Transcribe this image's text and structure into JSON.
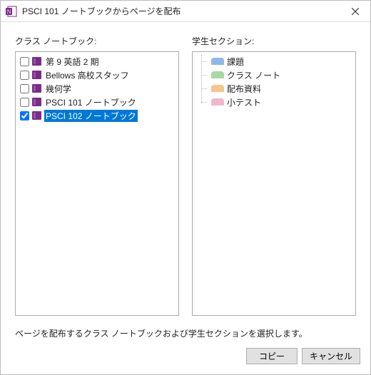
{
  "window": {
    "title": "PSCI 101 ノートブックからページを配布"
  },
  "left": {
    "heading": "クラス ノートブック:",
    "items": [
      {
        "label": "第 9 英語 2 期",
        "checked": false,
        "selected": false,
        "color": "#7b2b8a"
      },
      {
        "label": "Bellows 高校スタッフ",
        "checked": false,
        "selected": false,
        "color": "#7b2b8a"
      },
      {
        "label": "幾何学",
        "checked": false,
        "selected": false,
        "color": "#7b2b8a"
      },
      {
        "label": "PSCI 101 ノートブック",
        "checked": false,
        "selected": false,
        "color": "#7b2b8a"
      },
      {
        "label": "PSCI 102 ノートブック",
        "checked": true,
        "selected": true,
        "color": "#7b2b8a"
      }
    ]
  },
  "right": {
    "heading": "学生セクション:",
    "items": [
      {
        "label": "課題",
        "color": "#8fb8e8"
      },
      {
        "label": "クラス ノート",
        "color": "#a9d8a4"
      },
      {
        "label": "配布資料",
        "color": "#f6c58b"
      },
      {
        "label": "小テスト",
        "color": "#f2b6cf"
      }
    ]
  },
  "footer": {
    "instruction": "ページを配布するクラス ノートブックおよび学生セクションを選択します。",
    "copy": "コピー",
    "cancel": "キャンセル"
  }
}
